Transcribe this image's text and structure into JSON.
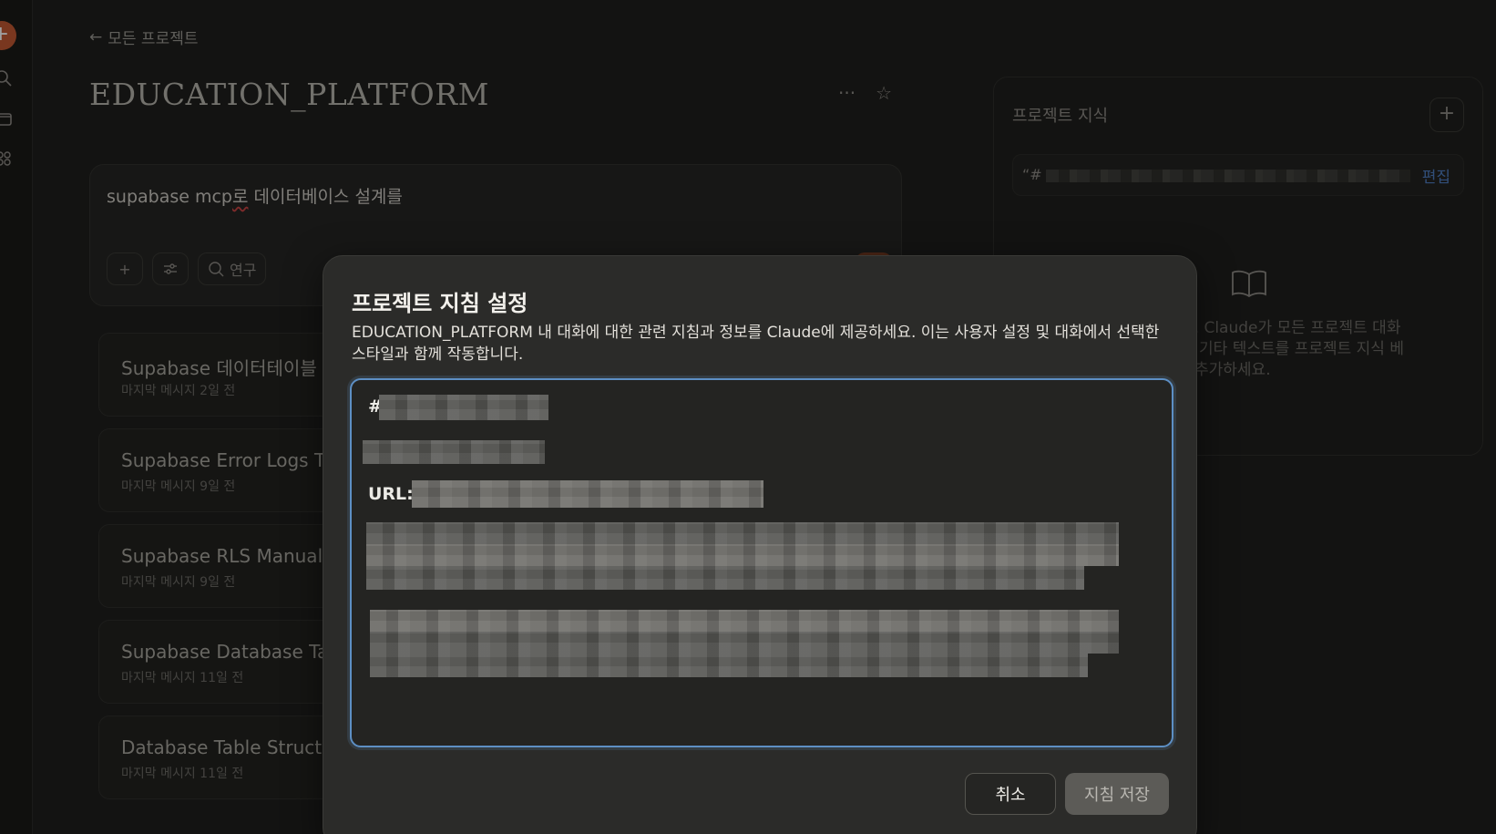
{
  "nav": {
    "back_label": "모든 프로젝트"
  },
  "project": {
    "title": "EDUCATION_PLATFORM",
    "more_glyph": "···",
    "star_glyph": "☆"
  },
  "composer": {
    "text_a": "supabase mcp",
    "text_b": "로",
    "text_c": " 데이터베이스 설계를",
    "research_label": "연구"
  },
  "chats": [
    {
      "title": "Supabase 데이터테이블 -",
      "meta": "마지막 메시지 2일 전"
    },
    {
      "title": "Supabase Error Logs Ta",
      "meta": "마지막 메시지 9일 전"
    },
    {
      "title": "Supabase RLS Manual S",
      "meta": "마지막 메시지 9일 전"
    },
    {
      "title": "Supabase Database Tab",
      "meta": "마지막 메시지 11일 전"
    },
    {
      "title": "Database Table Structu",
      "meta": "마지막 메시지 11일 전"
    }
  ],
  "knowledge": {
    "title": "프로젝트 지식",
    "add_glyph": "+",
    "item_prefix": "“#",
    "edit_label": "편집",
    "empty_line1": "다. Claude가 모든 프로젝트 대화",
    "empty_line2": "는 기타 텍스트를 프로젝트 지식 베",
    "empty_line3": "추가하세요."
  },
  "modal": {
    "title": "프로젝트 지침 설정",
    "description": "EDUCATION_PLATFORM 내 대화에 대한 관련 지침과 정보를 Claude에 제공하세요. 이는 사용자 설정 및 대화에서 선택한 스타일과 함께 작동합니다.",
    "editor": {
      "line1": "#",
      "line3": "URL:"
    },
    "cancel_label": "취소",
    "save_label": "지침 저장"
  },
  "colors": {
    "accent": "#c45a32",
    "focus_border": "#5d8fc4",
    "edit_link": "#4f7fc3"
  }
}
